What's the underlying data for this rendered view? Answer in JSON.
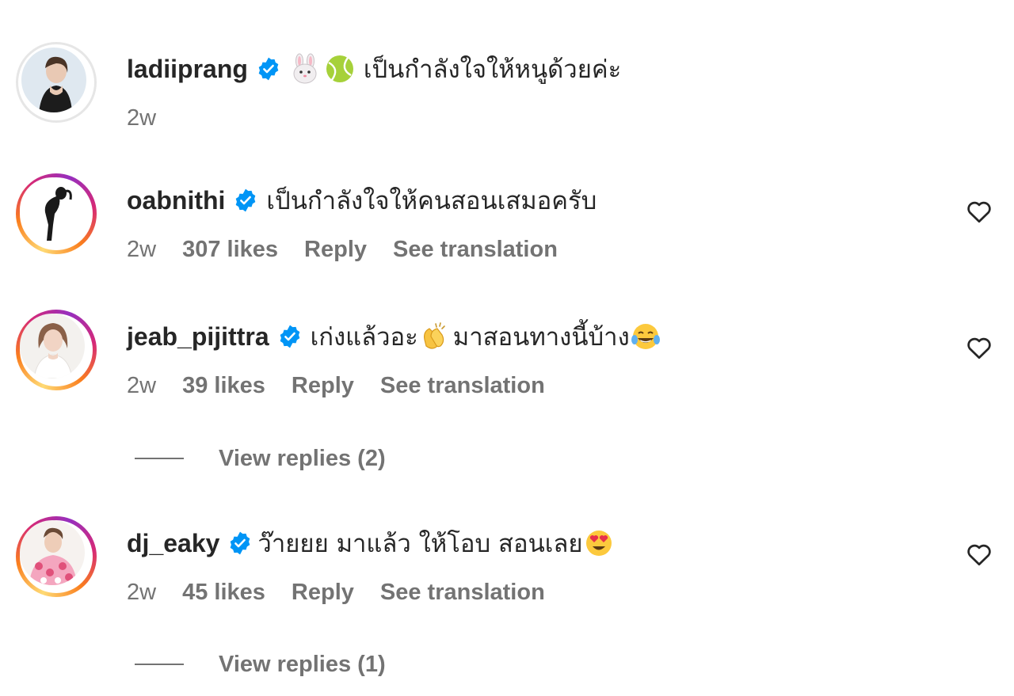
{
  "comments": [
    {
      "username": "ladiiprang",
      "text": "เป็นกำลังใจให้หนูด้วยค่ะ",
      "emoji_icons": [
        "rabbit-face-icon",
        "tennis-ball-icon"
      ],
      "time": "2w",
      "likes": "",
      "reply": "",
      "translate": "",
      "story_ring": false
    },
    {
      "username": "oabnithi",
      "text": "เป็นกำลังใจให้คนสอนเสมอครับ",
      "time": "2w",
      "likes": "307 likes",
      "reply": "Reply",
      "translate": "See translation",
      "story_ring": true
    },
    {
      "username": "jeab_pijittra",
      "text_part1": "เก่งแล้วอะ",
      "text_part2": " มาสอนทางนี้บ้าง ",
      "emoji_icons": [
        "clapping-hands-icon",
        "tears-of-joy-icon"
      ],
      "time": "2w",
      "likes": "39 likes",
      "reply": "Reply",
      "translate": "See translation",
      "story_ring": true,
      "view_replies": "View replies (2)"
    },
    {
      "username": "dj_eaky",
      "text": "ว๊ายยย มาแล้ว ให้โอบ สอนเลย ",
      "emoji_icons": [
        "heart-eyes-icon"
      ],
      "time": "2w",
      "likes": "45 likes",
      "reply": "Reply",
      "translate": "See translation",
      "story_ring": true,
      "view_replies": "View replies (1)"
    }
  ],
  "colors": {
    "verified_blue": "#0095f6",
    "secondary_text": "#737373",
    "primary_text": "#262626"
  }
}
